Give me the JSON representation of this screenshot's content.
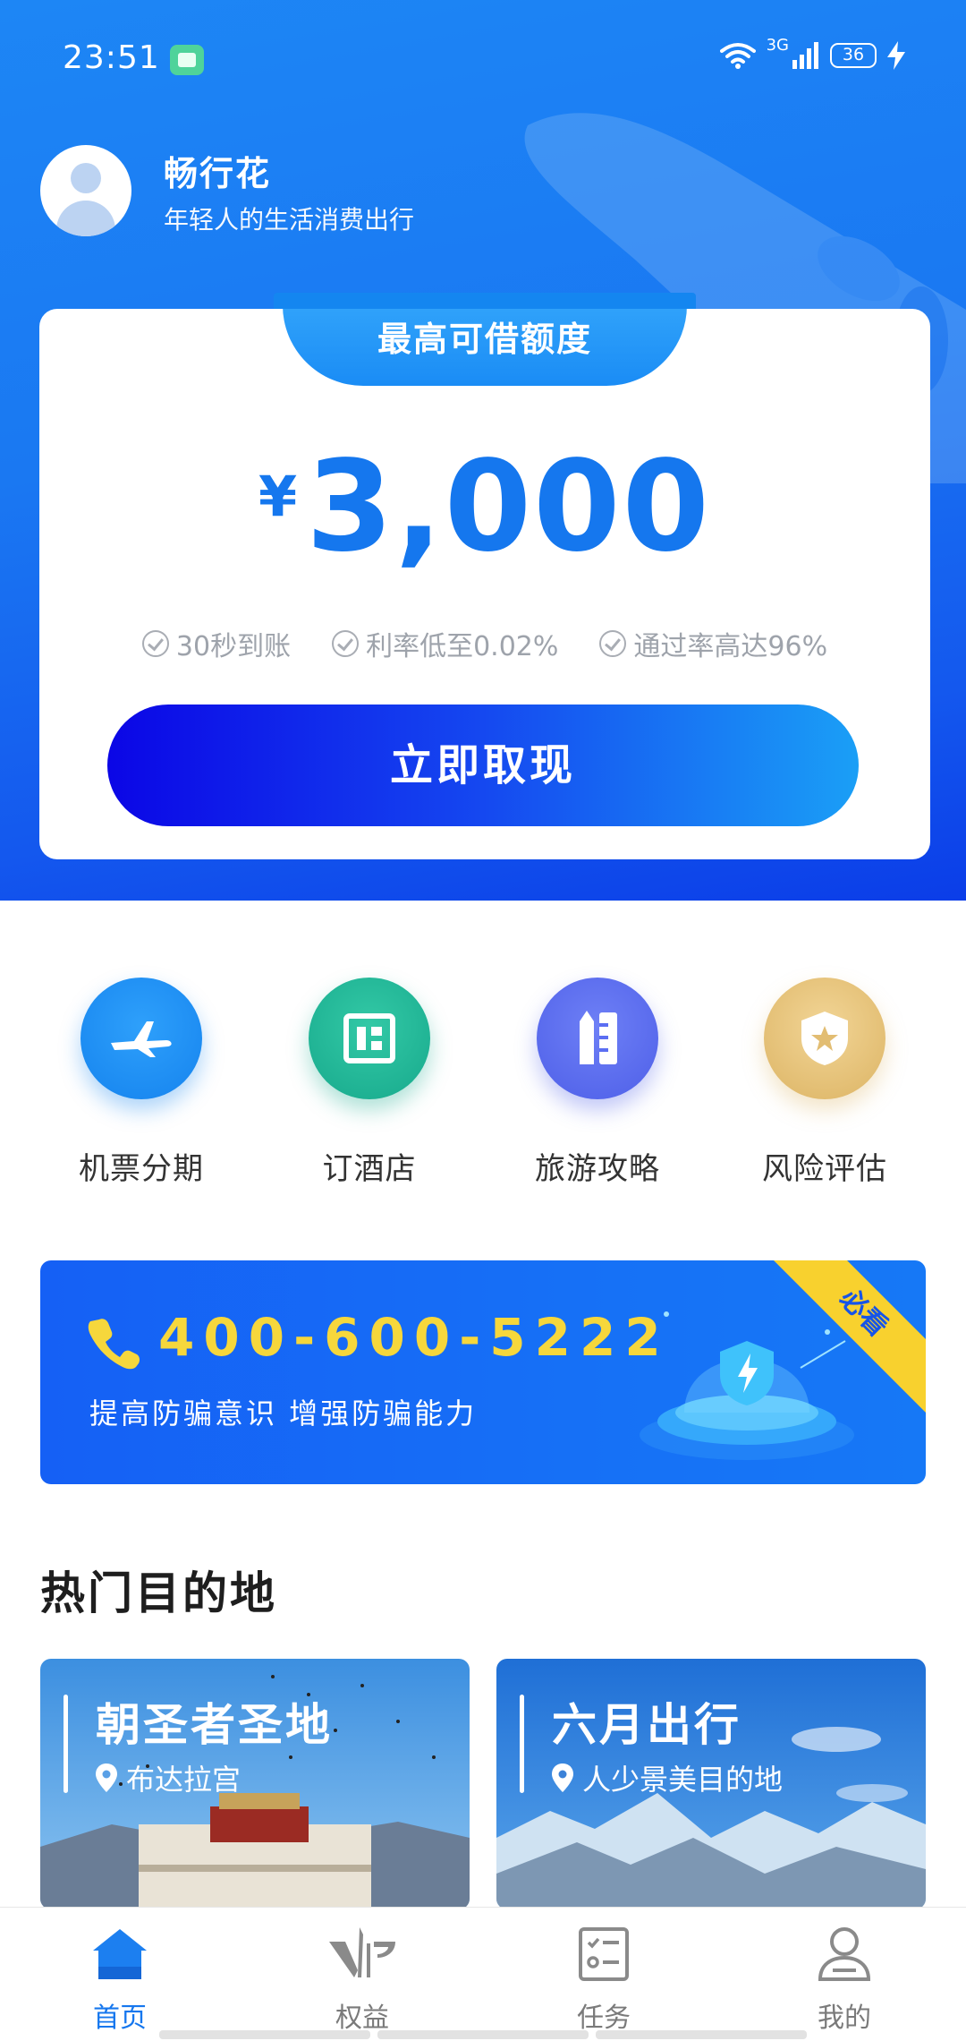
{
  "status_bar": {
    "time": "23:51",
    "network": "3G",
    "battery": "36"
  },
  "profile": {
    "name": "畅行花",
    "subtitle": "年轻人的生活消费出行"
  },
  "credit": {
    "tab_label": "最高可借额度",
    "currency": "¥",
    "amount": "3,000",
    "features": [
      "30秒到账",
      "利率低至0.02%",
      "通过率高达96%"
    ],
    "button_label": "立即取现"
  },
  "quick_actions": [
    {
      "label": "机票分期",
      "icon": "airplane-icon",
      "color": "#1a8cf2"
    },
    {
      "label": "订酒店",
      "icon": "hotel-icon",
      "color": "#22b89a"
    },
    {
      "label": "旅游攻略",
      "icon": "guide-icon",
      "color": "#5b6ef2"
    },
    {
      "label": "风险评估",
      "icon": "shield-star-icon",
      "color": "#e2bd72"
    }
  ],
  "banner": {
    "phone": "400-600-5222",
    "slogan": "提高防骗意识  增强防骗能力",
    "ribbon": "必看"
  },
  "hot_destinations": {
    "title": "热门目的地",
    "items": [
      {
        "title": "朝圣者圣地",
        "location": "布达拉宫"
      },
      {
        "title": "六月出行",
        "location": "人少景美目的地"
      }
    ]
  },
  "tab_bar": [
    {
      "label": "首页",
      "icon": "home-icon",
      "active": true
    },
    {
      "label": "权益",
      "icon": "vip-icon",
      "active": false
    },
    {
      "label": "任务",
      "icon": "task-list-icon",
      "active": false
    },
    {
      "label": "我的",
      "icon": "user-icon",
      "active": false
    }
  ],
  "colors": {
    "brand_blue": "#1677ee",
    "accent_yellow": "#f6d73c"
  }
}
